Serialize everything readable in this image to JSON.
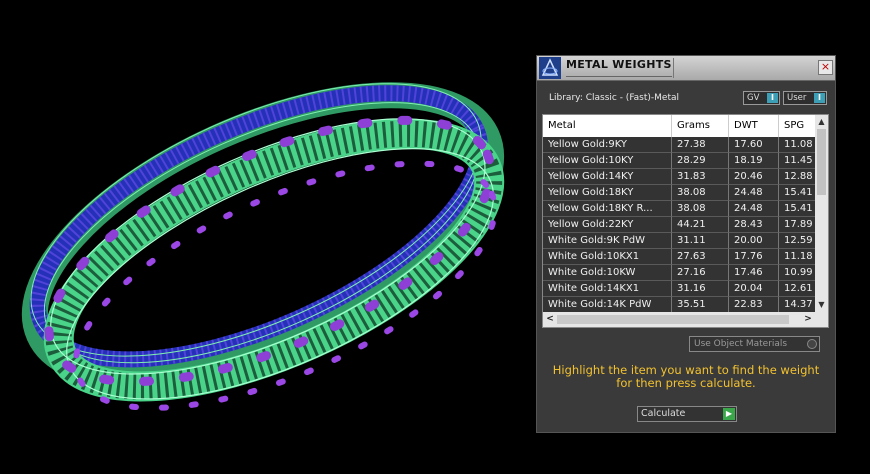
{
  "panel": {
    "title": "METAL WEIGHTS",
    "close_icon": "×",
    "library_label": "Library: Classic - (Fast)-Metal",
    "gv_toggle": "GV",
    "user_toggle": "User",
    "toggle_indicator": "I",
    "use_object_materials": "Use Object Materials",
    "instructions_line1": "Highlight the item you want to find the weight",
    "instructions_line2": "for then press calculate.",
    "calculate_label": "Calculate",
    "calculate_icon": "▶"
  },
  "table": {
    "columns": [
      "Metal",
      "Grams",
      "DWT",
      "SPG"
    ],
    "rows": [
      [
        "Yellow Gold:9KY",
        "27.38",
        "17.60",
        "11.08"
      ],
      [
        "Yellow Gold:10KY",
        "28.29",
        "18.19",
        "11.45"
      ],
      [
        "Yellow Gold:14KY",
        "31.83",
        "20.46",
        "12.88"
      ],
      [
        "Yellow Gold:18KY",
        "38.08",
        "24.48",
        "15.41"
      ],
      [
        "Yellow Gold:18KY R...",
        "38.08",
        "24.48",
        "15.41"
      ],
      [
        "Yellow Gold:22KY",
        "44.21",
        "28.43",
        "17.89"
      ],
      [
        "White Gold:9K PdW",
        "31.11",
        "20.00",
        "12.59"
      ],
      [
        "White Gold:10KX1",
        "27.63",
        "17.76",
        "11.18"
      ],
      [
        "White Gold:10KW",
        "27.16",
        "17.46",
        "10.99"
      ],
      [
        "White Gold:14KX1",
        "31.16",
        "20.04",
        "12.61"
      ],
      [
        "White Gold:14K PdW",
        "35.51",
        "22.83",
        "14.37"
      ]
    ],
    "scroll_up": "▲",
    "scroll_down": "▼",
    "scroll_left": "<",
    "scroll_right": ">"
  },
  "colors": {
    "background": "#000000",
    "panel": "#3a3a3a",
    "instructions": "#f2c230",
    "metal_green": "#3fc77a",
    "gem_blue": "#2b33c9",
    "prong_purple": "#8a3fd1",
    "toggle_indicator": "#3d9fb5",
    "calculate_icon": "#3aa84a"
  },
  "icons": [
    "app-logo-icon",
    "close-icon",
    "toggle-indicator-icon",
    "scroll-arrow-icon",
    "play-arrow-icon"
  ]
}
